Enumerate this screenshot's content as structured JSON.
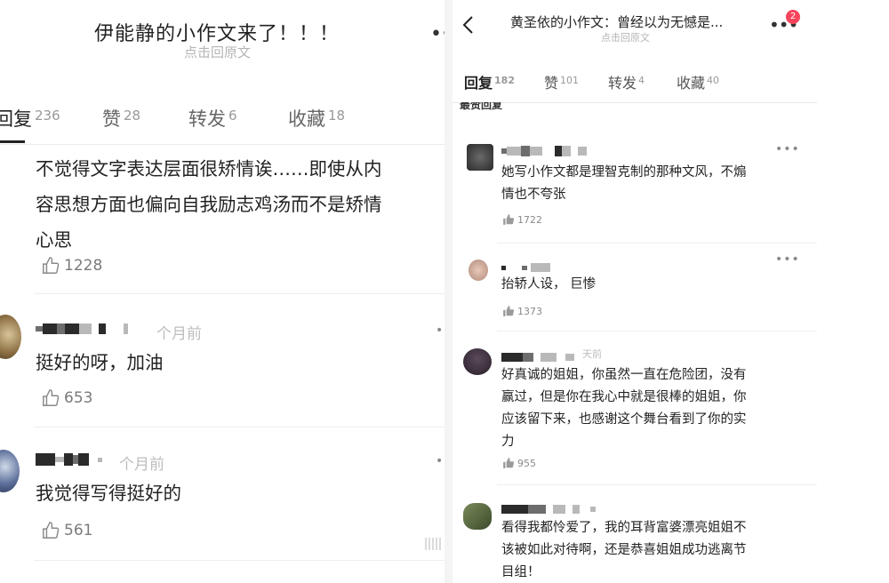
{
  "left": {
    "title": "伊能静的小作文来了！！！",
    "subtitle": "点击回原文",
    "more_label": "•••",
    "tabs": [
      {
        "label": "回复",
        "count": "236"
      },
      {
        "label": "赞",
        "count": "28"
      },
      {
        "label": "转发",
        "count": "6"
      },
      {
        "label": "收藏",
        "count": "18"
      }
    ],
    "comments": [
      {
        "lines": [
          "不觉得文字表达层面很矫情诶……即使从内",
          "容思想方面也偏向自我励志鸡汤而不是矫情",
          "心思"
        ],
        "likes": "1228"
      },
      {
        "time": "个月前",
        "lines": [
          "挺好的呀，加油"
        ],
        "likes": "653"
      },
      {
        "time": "个月前",
        "lines": [
          "我觉得写得挺好的"
        ],
        "likes": "561"
      }
    ]
  },
  "right": {
    "title": "黄圣依的小作文：曾经以为无憾是...",
    "subtitle": "点击回原文",
    "more_label": "•••",
    "badge": "2",
    "tabs": [
      {
        "label": "回复",
        "count": "182"
      },
      {
        "label": "赞",
        "count": "101"
      },
      {
        "label": "转发",
        "count": "4"
      },
      {
        "label": "收藏",
        "count": "40"
      }
    ],
    "section_title": "最赞回复",
    "dots": "•••",
    "comments": [
      {
        "lines": [
          "她写小作文都是理智克制的那种文风，不煽",
          "情也不夸张"
        ],
        "likes": "1722"
      },
      {
        "lines": [
          "抬轿人设， 巨惨"
        ],
        "likes": "1373"
      },
      {
        "time": "天前",
        "lines": [
          "好真诚的姐姐，你虽然一直在危险团，没有",
          "赢过，但是你在我心中就是很棒的姐姐，你",
          "应该留下来，也感谢这个舞台看到了你的实",
          "力"
        ],
        "likes": "955"
      },
      {
        "lines": [
          "看得我都怜爱了，我的耳背富婆漂亮姐姐不",
          "该被如此对待啊，还是恭喜姐姐成功逃离节",
          "目组！"
        ]
      }
    ]
  }
}
